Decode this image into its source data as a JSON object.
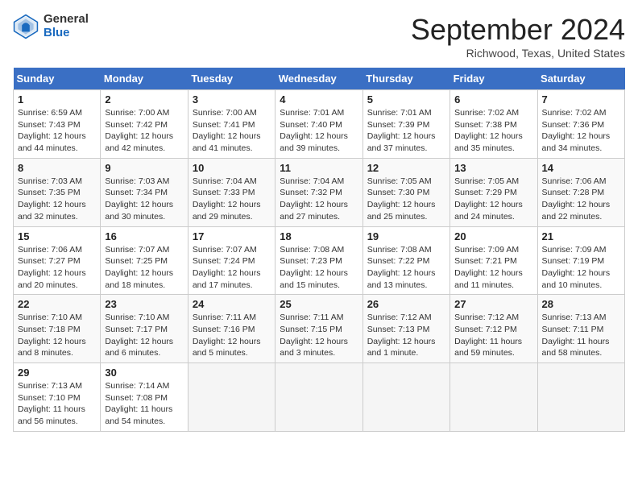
{
  "header": {
    "logo_general": "General",
    "logo_blue": "Blue",
    "month": "September 2024",
    "location": "Richwood, Texas, United States"
  },
  "days_of_week": [
    "Sunday",
    "Monday",
    "Tuesday",
    "Wednesday",
    "Thursday",
    "Friday",
    "Saturday"
  ],
  "weeks": [
    [
      {
        "day": "1",
        "sunrise": "6:59 AM",
        "sunset": "7:43 PM",
        "daylight": "12 hours and 44 minutes."
      },
      {
        "day": "2",
        "sunrise": "7:00 AM",
        "sunset": "7:42 PM",
        "daylight": "12 hours and 42 minutes."
      },
      {
        "day": "3",
        "sunrise": "7:00 AM",
        "sunset": "7:41 PM",
        "daylight": "12 hours and 41 minutes."
      },
      {
        "day": "4",
        "sunrise": "7:01 AM",
        "sunset": "7:40 PM",
        "daylight": "12 hours and 39 minutes."
      },
      {
        "day": "5",
        "sunrise": "7:01 AM",
        "sunset": "7:39 PM",
        "daylight": "12 hours and 37 minutes."
      },
      {
        "day": "6",
        "sunrise": "7:02 AM",
        "sunset": "7:38 PM",
        "daylight": "12 hours and 35 minutes."
      },
      {
        "day": "7",
        "sunrise": "7:02 AM",
        "sunset": "7:36 PM",
        "daylight": "12 hours and 34 minutes."
      }
    ],
    [
      {
        "day": "8",
        "sunrise": "7:03 AM",
        "sunset": "7:35 PM",
        "daylight": "12 hours and 32 minutes."
      },
      {
        "day": "9",
        "sunrise": "7:03 AM",
        "sunset": "7:34 PM",
        "daylight": "12 hours and 30 minutes."
      },
      {
        "day": "10",
        "sunrise": "7:04 AM",
        "sunset": "7:33 PM",
        "daylight": "12 hours and 29 minutes."
      },
      {
        "day": "11",
        "sunrise": "7:04 AM",
        "sunset": "7:32 PM",
        "daylight": "12 hours and 27 minutes."
      },
      {
        "day": "12",
        "sunrise": "7:05 AM",
        "sunset": "7:30 PM",
        "daylight": "12 hours and 25 minutes."
      },
      {
        "day": "13",
        "sunrise": "7:05 AM",
        "sunset": "7:29 PM",
        "daylight": "12 hours and 24 minutes."
      },
      {
        "day": "14",
        "sunrise": "7:06 AM",
        "sunset": "7:28 PM",
        "daylight": "12 hours and 22 minutes."
      }
    ],
    [
      {
        "day": "15",
        "sunrise": "7:06 AM",
        "sunset": "7:27 PM",
        "daylight": "12 hours and 20 minutes."
      },
      {
        "day": "16",
        "sunrise": "7:07 AM",
        "sunset": "7:25 PM",
        "daylight": "12 hours and 18 minutes."
      },
      {
        "day": "17",
        "sunrise": "7:07 AM",
        "sunset": "7:24 PM",
        "daylight": "12 hours and 17 minutes."
      },
      {
        "day": "18",
        "sunrise": "7:08 AM",
        "sunset": "7:23 PM",
        "daylight": "12 hours and 15 minutes."
      },
      {
        "day": "19",
        "sunrise": "7:08 AM",
        "sunset": "7:22 PM",
        "daylight": "12 hours and 13 minutes."
      },
      {
        "day": "20",
        "sunrise": "7:09 AM",
        "sunset": "7:21 PM",
        "daylight": "12 hours and 11 minutes."
      },
      {
        "day": "21",
        "sunrise": "7:09 AM",
        "sunset": "7:19 PM",
        "daylight": "12 hours and 10 minutes."
      }
    ],
    [
      {
        "day": "22",
        "sunrise": "7:10 AM",
        "sunset": "7:18 PM",
        "daylight": "12 hours and 8 minutes."
      },
      {
        "day": "23",
        "sunrise": "7:10 AM",
        "sunset": "7:17 PM",
        "daylight": "12 hours and 6 minutes."
      },
      {
        "day": "24",
        "sunrise": "7:11 AM",
        "sunset": "7:16 PM",
        "daylight": "12 hours and 5 minutes."
      },
      {
        "day": "25",
        "sunrise": "7:11 AM",
        "sunset": "7:15 PM",
        "daylight": "12 hours and 3 minutes."
      },
      {
        "day": "26",
        "sunrise": "7:12 AM",
        "sunset": "7:13 PM",
        "daylight": "12 hours and 1 minute."
      },
      {
        "day": "27",
        "sunrise": "7:12 AM",
        "sunset": "7:12 PM",
        "daylight": "11 hours and 59 minutes."
      },
      {
        "day": "28",
        "sunrise": "7:13 AM",
        "sunset": "7:11 PM",
        "daylight": "11 hours and 58 minutes."
      }
    ],
    [
      {
        "day": "29",
        "sunrise": "7:13 AM",
        "sunset": "7:10 PM",
        "daylight": "11 hours and 56 minutes."
      },
      {
        "day": "30",
        "sunrise": "7:14 AM",
        "sunset": "7:08 PM",
        "daylight": "11 hours and 54 minutes."
      },
      null,
      null,
      null,
      null,
      null
    ]
  ]
}
